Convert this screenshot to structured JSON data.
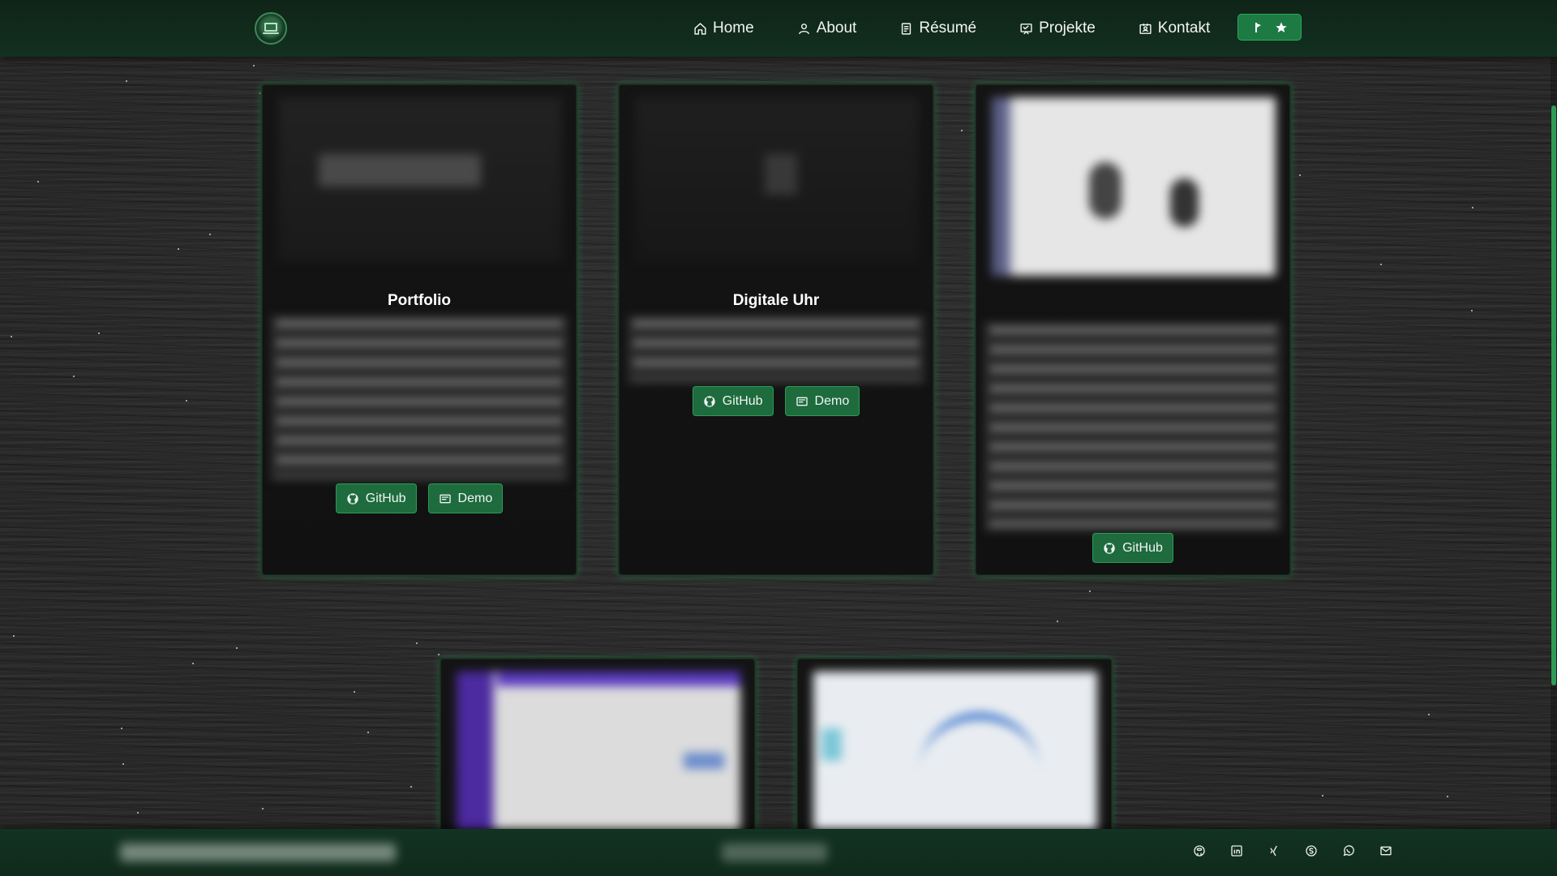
{
  "nav": {
    "items": [
      {
        "label": "Home",
        "icon": "home-icon"
      },
      {
        "label": "About",
        "icon": "user-icon"
      },
      {
        "label": "Résumé",
        "icon": "document-icon"
      },
      {
        "label": "Projekte",
        "icon": "projects-icon"
      },
      {
        "label": "Kontakt",
        "icon": "contact-card-icon"
      }
    ],
    "theme_toggle": {
      "icons": [
        "sun-icon",
        "star-icon"
      ]
    }
  },
  "cards": [
    {
      "title": "Portfolio",
      "buttons": [
        {
          "label": "GitHub",
          "icon": "github-icon"
        },
        {
          "label": "Demo",
          "icon": "demo-icon"
        }
      ]
    },
    {
      "title": "Digitale Uhr",
      "buttons": [
        {
          "label": "GitHub",
          "icon": "github-icon"
        },
        {
          "label": "Demo",
          "icon": "demo-icon"
        }
      ]
    },
    {
      "title": "",
      "buttons": [
        {
          "label": "GitHub",
          "icon": "github-icon"
        }
      ]
    },
    {
      "title": "",
      "buttons": []
    },
    {
      "title": "",
      "buttons": []
    }
  ],
  "footer": {
    "social_icons": [
      "github-icon",
      "linkedin-icon",
      "xing-icon",
      "skype-icon",
      "whatsapp-icon",
      "mail-icon"
    ]
  },
  "colors": {
    "nav_bg": "#123020",
    "accent": "#1e6b3e",
    "card_glow": "#2ea05a"
  }
}
